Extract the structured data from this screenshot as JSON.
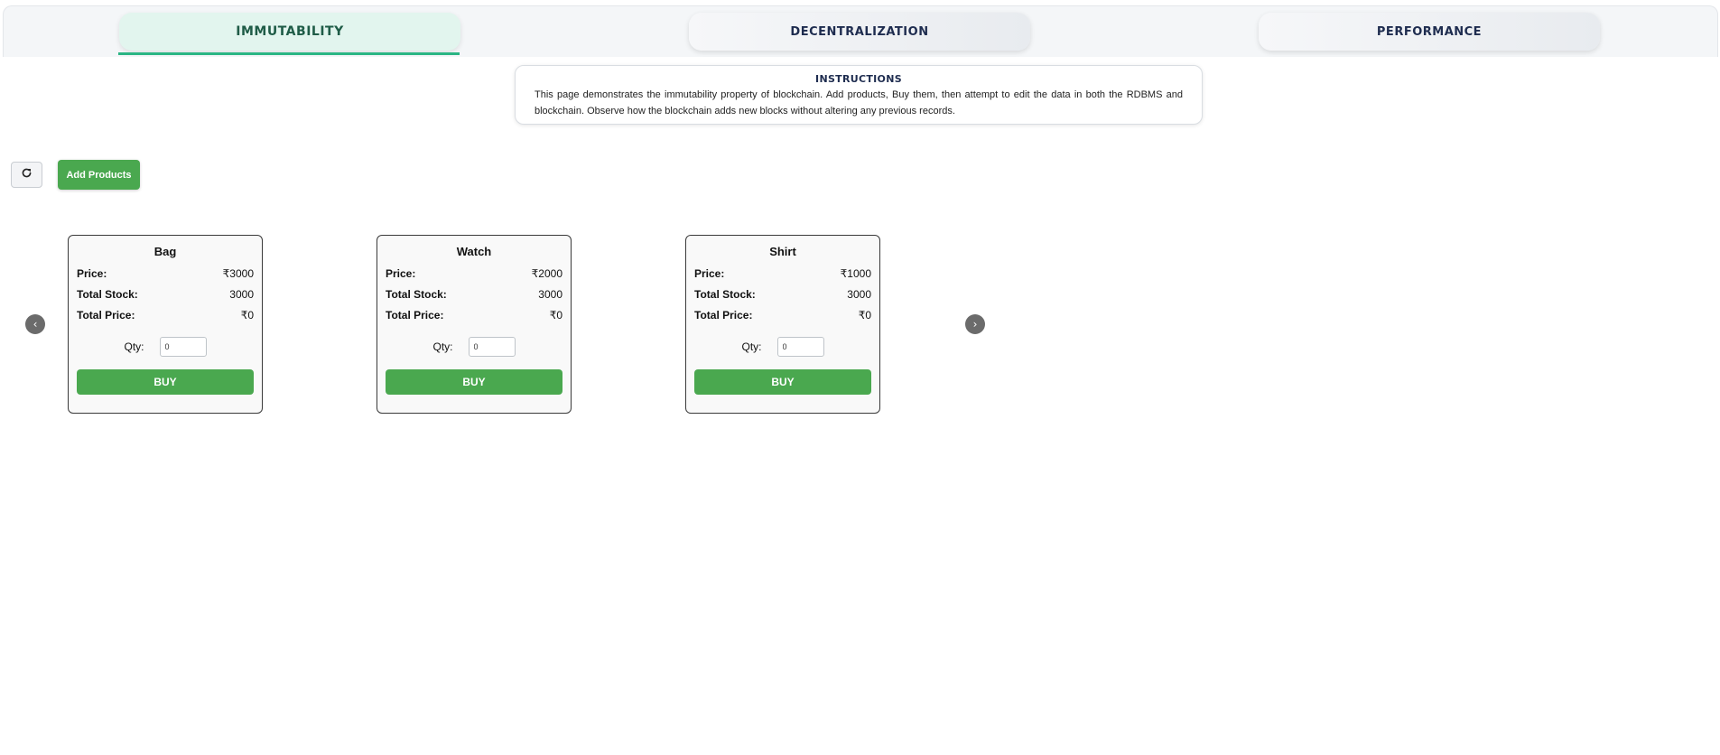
{
  "tabs": [
    {
      "label": "IMMUTABILITY",
      "active": true
    },
    {
      "label": "DECENTRALIZATION",
      "active": false
    },
    {
      "label": "PERFORMANCE",
      "active": false
    }
  ],
  "instructions": {
    "title": "INSTRUCTIONS",
    "text": "This page demonstrates the immutability property of blockchain. Add products, Buy them, then attempt to edit the data in both the RDBMS and blockchain. Observe how the blockchain adds new blocks without altering any previous records."
  },
  "toolbar": {
    "refresh_icon": "refresh-icon",
    "add_label": "Add Products"
  },
  "carousel": {
    "prev_icon": "chevron-left-icon",
    "next_icon": "chevron-right-icon",
    "prev_glyph": "‹",
    "next_glyph": "›"
  },
  "labels": {
    "price": "Price:",
    "total_stock": "Total Stock:",
    "total_price": "Total Price:",
    "qty": "Qty:",
    "buy": "BUY"
  },
  "products": [
    {
      "name": "Bag",
      "price": "₹3000",
      "total_stock": "3000",
      "total_price": "₹0",
      "qty": "0"
    },
    {
      "name": "Watch",
      "price": "₹2000",
      "total_stock": "3000",
      "total_price": "₹0",
      "qty": "0"
    },
    {
      "name": "Shirt",
      "price": "₹1000",
      "total_stock": "3000",
      "total_price": "₹0",
      "qty": "0"
    }
  ],
  "colors": {
    "accent_green": "#4aa84f",
    "tab_active_bg": "#e2f5ee",
    "tab_underline": "#2bb584",
    "tab_text": "#1e2c4f"
  }
}
